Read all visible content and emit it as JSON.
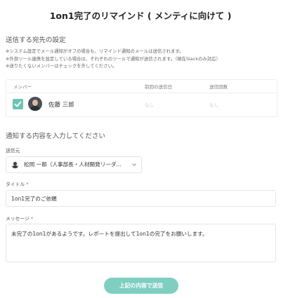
{
  "page": {
    "title": "1on1完了のリマインド ( メンティに向けて )"
  },
  "recipients": {
    "heading": "送信する宛先の設定",
    "notes": [
      "※システム設定でメール通知がオフの場合も、リマインド通知のメールは送信されます。",
      "※外部ツール連携を設定している場合は、それぞれのツールで通知が送信されます。（現在Slackのみ対応）",
      "※送りたくないメンバーはチェックを外してください。"
    ],
    "table": {
      "columns": {
        "member": "メンバー",
        "last_sent": "前回の送信日",
        "send_count": "送信回数"
      },
      "rows": [
        {
          "checked": true,
          "name": "佐藤 三郎",
          "last_sent": "なし",
          "send_count": "なし"
        }
      ]
    }
  },
  "content": {
    "heading": "通知する内容を入力してください",
    "sender": {
      "label": "送信元",
      "value": "松岡 一郎（人事部長・人材開発リーダ..."
    },
    "title_field": {
      "label": "タイトル",
      "required_mark": "*",
      "value": "1on1完了のご依頼"
    },
    "message_field": {
      "label": "メッセージ",
      "required_mark": "*",
      "value": "未完了の1on1があるようです。レポートを提出して1on1の完了をお願いします。"
    }
  },
  "actions": {
    "submit_label": "上記の内容で送信"
  },
  "colors": {
    "accent": "#6cc4b5",
    "submit_bg": "#7fcfc1",
    "required": "#e05a5a"
  }
}
